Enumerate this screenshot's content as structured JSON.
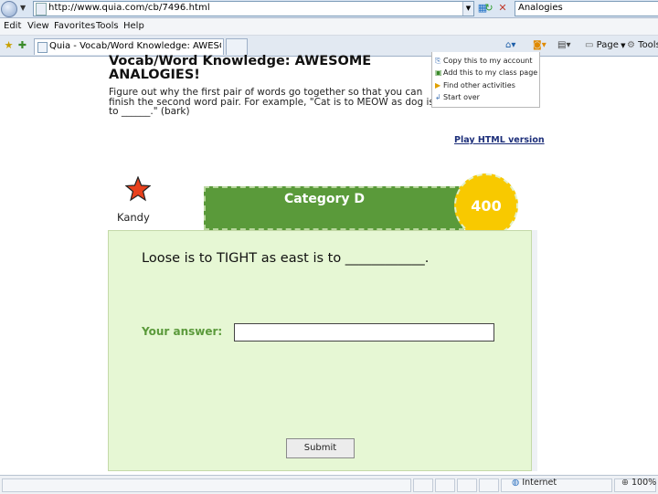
{
  "browser": {
    "url": "http://www.quia.com/cb/7496.html",
    "search_value": "Analogies",
    "menu": [
      "Edit",
      "View",
      "Favorites",
      "Tools",
      "Help"
    ],
    "tab_title": "Quia - Vocab/Word Knowledge: AWESOME ANALOGIES!",
    "commands": {
      "page": "Page",
      "tools": "Tools"
    },
    "status": {
      "zone": "Internet",
      "zoom": "100%"
    }
  },
  "page": {
    "title": "Vocab/Word Knowledge: AWESOME ANALOGIES!",
    "instructions": "Figure out why the first pair of words go together so that you can finish the second word pair. For example, \"Cat is to MEOW as dog is to ______.\" (bark)",
    "side_links": [
      "Copy this to my account",
      "Add this to my class page",
      "Find other activities",
      "Start over"
    ],
    "play_html_link": "Play HTML version",
    "player_name": "Kandy",
    "category": "Category D",
    "points": "400",
    "question": "Loose is to TIGHT as east is to ____________.",
    "answer_label": "Your answer:",
    "answer_value": "",
    "submit_label": "Submit"
  }
}
